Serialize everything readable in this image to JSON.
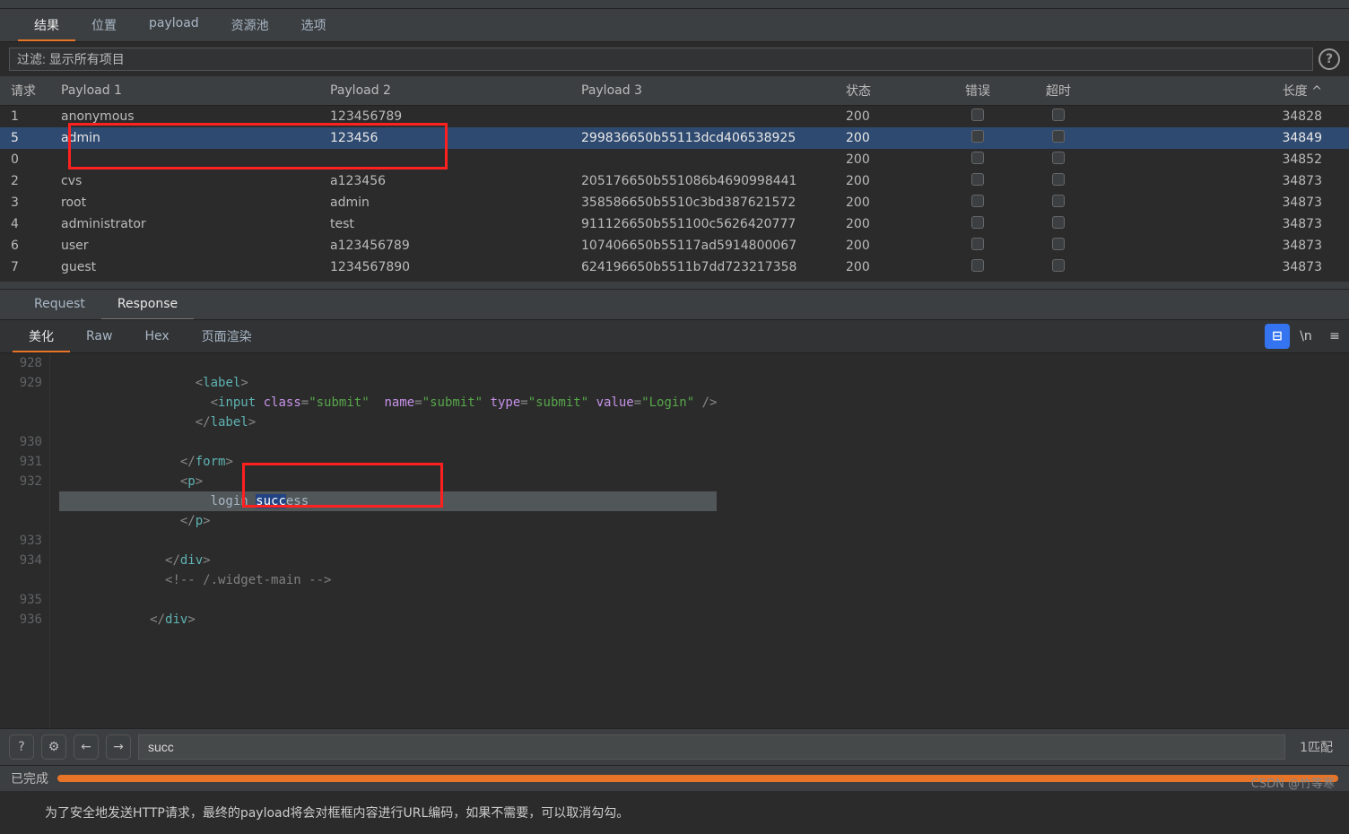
{
  "main_tabs": [
    "结果",
    "位置",
    "payload",
    "资源池",
    "选项"
  ],
  "filter": {
    "label": "过滤:",
    "value": "显示所有项目"
  },
  "columns": {
    "request": "请求",
    "p1": "Payload 1",
    "p2": "Payload 2",
    "p3": "Payload 3",
    "status": "状态",
    "error": "错误",
    "timeout": "超时",
    "length": "长度"
  },
  "rows": [
    {
      "req": "1",
      "p1": "anonymous",
      "p2": "123456789",
      "p3": "",
      "status": "200",
      "len": "34828",
      "sel": false
    },
    {
      "req": "5",
      "p1": "admin",
      "p2": "123456",
      "p3": "299836650b55113dcd406538925",
      "status": "200",
      "len": "34849",
      "sel": true
    },
    {
      "req": "0",
      "p1": "",
      "p2": "",
      "p3": "",
      "status": "200",
      "len": "34852",
      "sel": false
    },
    {
      "req": "2",
      "p1": "cvs",
      "p2": "a123456",
      "p3": "205176650b551086b4690998441",
      "status": "200",
      "len": "34873",
      "sel": false
    },
    {
      "req": "3",
      "p1": "root",
      "p2": "admin",
      "p3": "358586650b5510c3bd387621572",
      "status": "200",
      "len": "34873",
      "sel": false
    },
    {
      "req": "4",
      "p1": "administrator",
      "p2": "test",
      "p3": "911126650b551100c5626420777",
      "status": "200",
      "len": "34873",
      "sel": false
    },
    {
      "req": "6",
      "p1": "user",
      "p2": "a123456789",
      "p3": "107406650b55117ad5914800067",
      "status": "200",
      "len": "34873",
      "sel": false
    },
    {
      "req": "7",
      "p1": "guest",
      "p2": "1234567890",
      "p3": "624196650b5511b7dd723217358",
      "status": "200",
      "len": "34873",
      "sel": false
    }
  ],
  "sub_tabs": [
    "Request",
    "Response"
  ],
  "view_tabs": [
    "美化",
    "Raw",
    "Hex",
    "页面渲染"
  ],
  "code": {
    "lines": [
      "928",
      "929",
      "",
      "",
      "930",
      "931",
      "932",
      "",
      "",
      "933",
      "934",
      "",
      "935",
      "936"
    ],
    "l929_indent": "                  ",
    "l929_tag": "label",
    "linput_indent": "                    ",
    "linput_class": "submit",
    "linput_name": "submit",
    "linput_type": "submit",
    "linput_value": "Login",
    "l931_indent": "                ",
    "l931_tag": "form",
    "l932_indent": "                ",
    "l932_tag": "p",
    "login_indent": "                    ",
    "login_text1": "login ",
    "login_sel": "succ",
    "login_text2": "ess",
    "l934_indent": "              ",
    "l934_tag": "div",
    "comment_indent": "              ",
    "comment_text": "<!-- /.widget-main -->",
    "l936_indent": "            ",
    "l936_tag": "div"
  },
  "search": {
    "value": "succ",
    "matches": "1匹配"
  },
  "status": {
    "text": "已完成"
  },
  "hint": "为了安全地发送HTTP请求，最终的payload将会对框框内容进行URL编码，如果不需要，可以取消勾勾。",
  "watermark": "CSDN @竹等寒"
}
